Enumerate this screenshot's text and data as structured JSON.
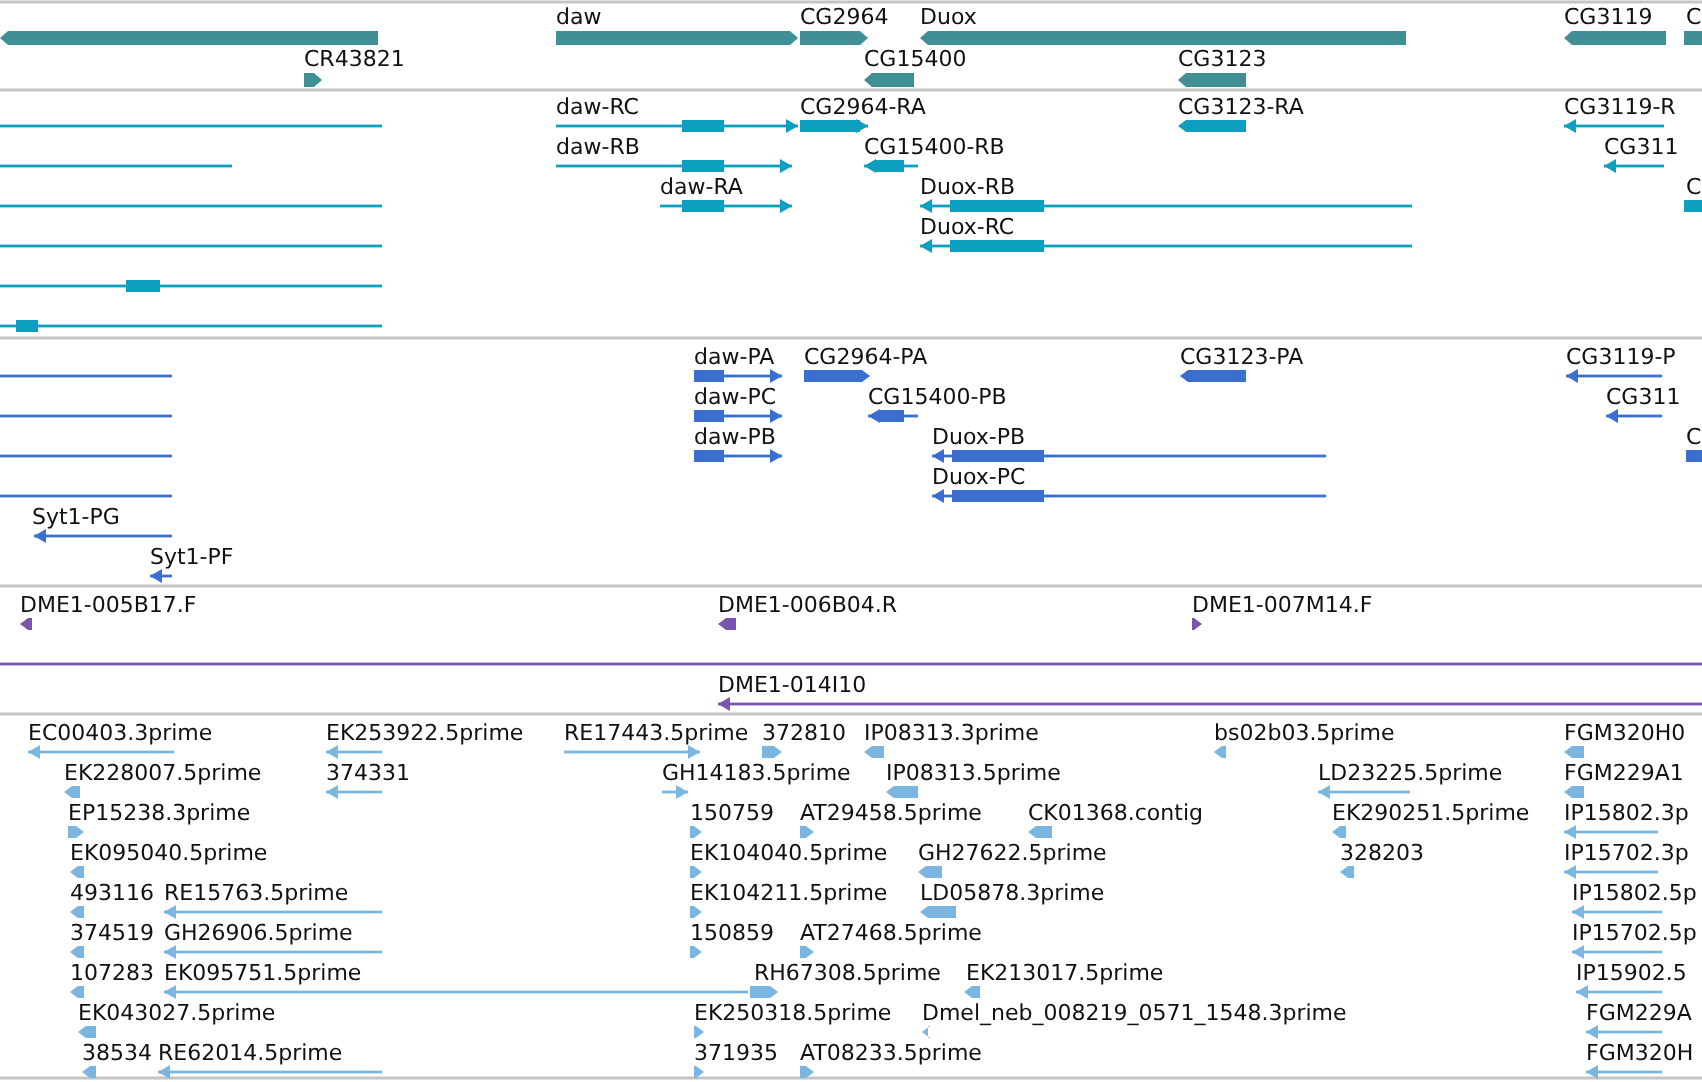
{
  "tracks": [
    {
      "kind": "gene",
      "features": [
        {
          "forward": false
        },
        {
          "label": "daw",
          "forward": true
        },
        {
          "label": "CG2964",
          "forward": true
        },
        {
          "label": "Duox",
          "forward": false
        },
        {
          "label": "CG3119",
          "forward": false
        },
        {
          "label": "C"
        },
        {
          "label": "CR43821",
          "forward": true
        },
        {
          "label": "CG15400",
          "forward": false
        },
        {
          "label": "CG3123",
          "forward": false
        }
      ]
    },
    {
      "kind": "transcript",
      "features": [
        {
          "forward": false
        },
        {
          "label": "daw-RC",
          "forward": true
        },
        {
          "label": "CG2964-RA",
          "forward": true
        },
        {
          "label": "CG3123-RA",
          "forward": false
        },
        {
          "label": "CG3119-R",
          "forward": false
        },
        {
          "forward": false
        },
        {
          "label": "daw-RB",
          "forward": true
        },
        {
          "label": "CG15400-RB",
          "forward": false
        },
        {
          "label": "CG311",
          "forward": false
        },
        {
          "forward": false
        },
        {
          "label": "daw-RA",
          "forward": true
        },
        {
          "label": "Duox-RB",
          "forward": false
        },
        {
          "label": "C"
        },
        {
          "forward": false
        },
        {
          "label": "Duox-RC",
          "forward": false
        },
        {
          "forward": false
        },
        {
          "forward": false
        }
      ]
    },
    {
      "kind": "protein",
      "features": [
        {
          "forward": false
        },
        {
          "label": "daw-PA",
          "forward": true
        },
        {
          "label": "CG2964-PA",
          "forward": true
        },
        {
          "label": "CG3123-PA",
          "forward": false
        },
        {
          "label": "CG3119-P",
          "forward": false
        },
        {
          "forward": false
        },
        {
          "label": "daw-PC",
          "forward": true
        },
        {
          "label": "CG15400-PB",
          "forward": false
        },
        {
          "label": "CG311",
          "forward": false
        },
        {
          "forward": false
        },
        {
          "label": "daw-PB",
          "forward": true
        },
        {
          "label": "Duox-PB",
          "forward": false
        },
        {
          "label": "C"
        },
        {
          "forward": false
        },
        {
          "label": "Duox-PC",
          "forward": false
        },
        {
          "label": "Syt1-PG",
          "forward": false
        },
        {
          "label": "Syt1-PF",
          "forward": false
        }
      ]
    },
    {
      "kind": "clone",
      "features": [
        {
          "label": "DME1-005B17.F",
          "forward": false
        },
        {
          "label": "DME1-006B04.R",
          "forward": false
        },
        {
          "label": "DME1-007M14.F",
          "forward": true
        },
        {
          "forward": false
        },
        {
          "label": "DME1-014I10",
          "forward": false
        }
      ]
    },
    {
      "kind": "est",
      "features": [
        {
          "label": "EC00403.3prime",
          "forward": false
        },
        {
          "label": "EK253922.5prime",
          "forward": false
        },
        {
          "label": "RE17443.5prime",
          "forward": true
        },
        {
          "label": "372810",
          "forward": true
        },
        {
          "label": "IP08313.3prime",
          "forward": false
        },
        {
          "label": "bs02b03.5prime",
          "forward": false
        },
        {
          "label": "FGM320H0",
          "forward": false
        },
        {
          "label": "EK228007.5prime",
          "forward": false
        },
        {
          "label": "374331",
          "forward": false
        },
        {
          "label": "GH14183.5prime",
          "forward": true
        },
        {
          "label": "IP08313.5prime",
          "forward": false
        },
        {
          "label": "LD23225.5prime",
          "forward": false
        },
        {
          "label": "FGM229A1",
          "forward": false
        },
        {
          "label": "EP15238.3prime",
          "forward": true
        },
        {
          "label": "150759",
          "forward": true
        },
        {
          "label": "AT29458.5prime",
          "forward": true
        },
        {
          "label": "CK01368.contig",
          "forward": false
        },
        {
          "label": "EK290251.5prime",
          "forward": false
        },
        {
          "label": "IP15802.3p",
          "forward": false
        },
        {
          "label": "EK095040.5prime",
          "forward": false
        },
        {
          "label": "EK104040.5prime",
          "forward": true
        },
        {
          "label": "GH27622.5prime",
          "forward": false
        },
        {
          "label": "328203",
          "forward": false
        },
        {
          "label": "IP15702.3p",
          "forward": false
        },
        {
          "label": "493116",
          "forward": false
        },
        {
          "label": "RE15763.5prime",
          "forward": false
        },
        {
          "label": "EK104211.5prime",
          "forward": true
        },
        {
          "label": "LD05878.3prime",
          "forward": false
        },
        {
          "label": "IP15802.5p",
          "forward": false
        },
        {
          "label": "374519",
          "forward": false
        },
        {
          "label": "GH26906.5prime",
          "forward": false
        },
        {
          "label": "150859",
          "forward": true
        },
        {
          "label": "AT27468.5prime",
          "forward": true
        },
        {
          "label": "IP15702.5p",
          "forward": false
        },
        {
          "label": "107283",
          "forward": false
        },
        {
          "label": "EK095751.5prime",
          "forward": false
        },
        {
          "label": "RH67308.5prime",
          "forward": true
        },
        {
          "label": "EK213017.5prime",
          "forward": false
        },
        {
          "label": "IP15902.5",
          "forward": false
        },
        {
          "label": "EK043027.5prime",
          "forward": false
        },
        {
          "label": "EK250318.5prime",
          "forward": true
        },
        {
          "label": "Dmel_neb_008219_0571_1548.3prime",
          "forward": false
        },
        {
          "label": "FGM229A",
          "forward": false
        },
        {
          "label": "38534",
          "forward": false
        },
        {
          "label": "RE62014.5prime",
          "forward": false
        },
        {
          "label": "371935",
          "forward": true
        },
        {
          "label": "AT08233.5prime",
          "forward": true
        },
        {
          "label": "FGM320H",
          "forward": false
        }
      ]
    }
  ]
}
